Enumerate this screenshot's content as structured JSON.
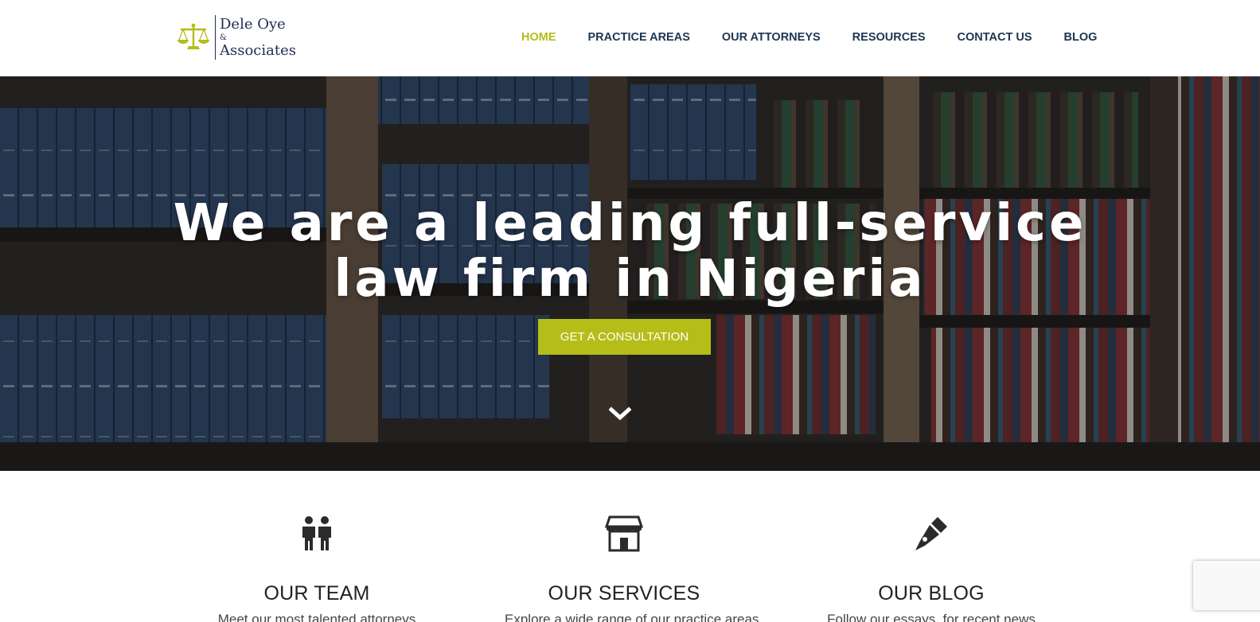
{
  "brand": {
    "line1": "Dele Oye",
    "amp": "&",
    "line3": "Associates",
    "accent_color": "#b5bd18",
    "navy_color": "#1e2e50"
  },
  "nav": {
    "items": [
      {
        "label": "HOME",
        "active": true
      },
      {
        "label": "PRACTICE AREAS",
        "active": false
      },
      {
        "label": "OUR ATTORNEYS",
        "active": false
      },
      {
        "label": "RESOURCES",
        "active": false
      },
      {
        "label": "CONTACT US",
        "active": false
      },
      {
        "label": "BLOG",
        "active": false
      }
    ]
  },
  "hero": {
    "title_line1": "We are a leading full-service",
    "title_line2": "law firm in Nigeria",
    "cta_label": "GET A CONSULTATION",
    "scroll_icon": "chevron-down-icon"
  },
  "features": [
    {
      "title": "OUR TEAM",
      "description": "Meet our most talented attorneys",
      "icon": "people-icon"
    },
    {
      "title": "OUR SERVICES",
      "description": "Explore a wide range of our practice areas",
      "icon": "storefront-icon"
    },
    {
      "title": "OUR BLOG",
      "description": "Follow our essays, for recent news",
      "icon": "pen-icon"
    }
  ]
}
